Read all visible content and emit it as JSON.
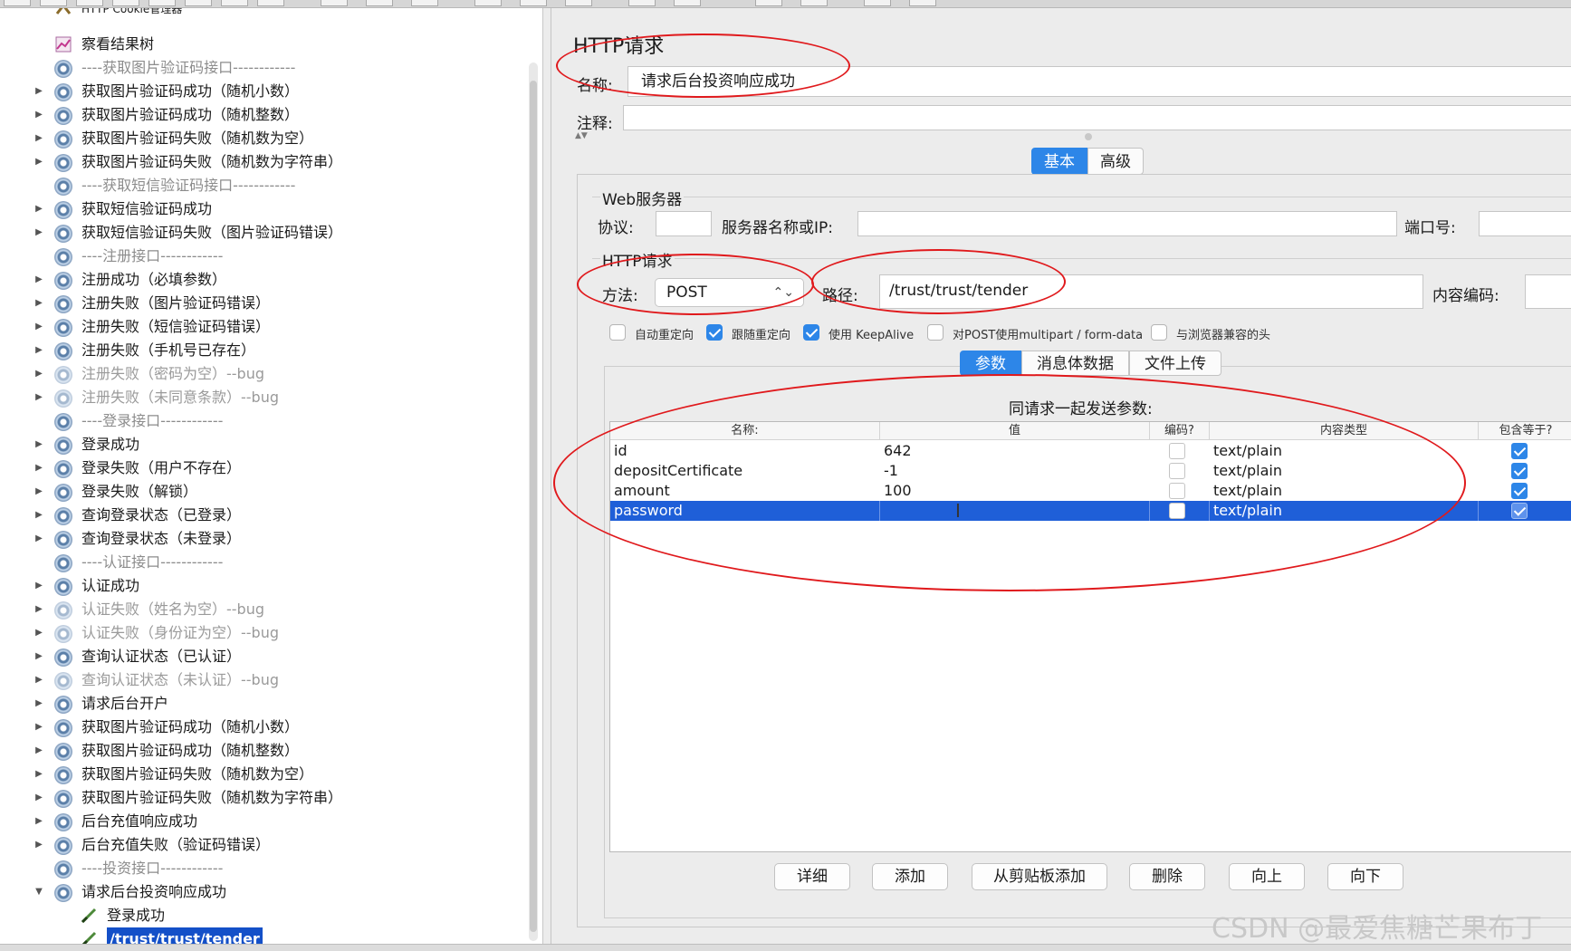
{
  "tree": {
    "items": [
      {
        "label": "HTTP Cookie管理器",
        "indent": 1,
        "kind": "cookie",
        "arrow": false,
        "style": "partial"
      },
      {
        "label": "察看结果树",
        "indent": 1,
        "kind": "listener",
        "arrow": false,
        "style": "normal"
      },
      {
        "label": "----获取图片验证码接口------------",
        "indent": 1,
        "kind": "gear",
        "arrow": false,
        "style": "sep"
      },
      {
        "label": "获取图片验证码成功（随机小数）",
        "indent": 1,
        "kind": "gear",
        "arrow": true,
        "style": "normal"
      },
      {
        "label": "获取图片验证码成功（随机整数）",
        "indent": 1,
        "kind": "gear",
        "arrow": true,
        "style": "normal"
      },
      {
        "label": "获取图片验证码失败（随机数为空）",
        "indent": 1,
        "kind": "gear",
        "arrow": true,
        "style": "normal"
      },
      {
        "label": "获取图片验证码失败（随机数为字符串）",
        "indent": 1,
        "kind": "gear",
        "arrow": true,
        "style": "normal"
      },
      {
        "label": "----获取短信验证码接口------------",
        "indent": 1,
        "kind": "gear",
        "arrow": false,
        "style": "sep"
      },
      {
        "label": "获取短信验证码成功",
        "indent": 1,
        "kind": "gear",
        "arrow": true,
        "style": "normal"
      },
      {
        "label": "获取短信验证码失败（图片验证码错误）",
        "indent": 1,
        "kind": "gear",
        "arrow": true,
        "style": "normal"
      },
      {
        "label": "----注册接口------------",
        "indent": 1,
        "kind": "gear",
        "arrow": false,
        "style": "sep"
      },
      {
        "label": "注册成功（必填参数）",
        "indent": 1,
        "kind": "gear",
        "arrow": true,
        "style": "normal"
      },
      {
        "label": "注册失败（图片验证码错误）",
        "indent": 1,
        "kind": "gear",
        "arrow": true,
        "style": "normal"
      },
      {
        "label": "注册失败（短信验证码错误）",
        "indent": 1,
        "kind": "gear",
        "arrow": true,
        "style": "normal"
      },
      {
        "label": "注册失败（手机号已存在）",
        "indent": 1,
        "kind": "gear",
        "arrow": true,
        "style": "normal"
      },
      {
        "label": "注册失败（密码为空）--bug",
        "indent": 1,
        "kind": "gear",
        "arrow": true,
        "style": "dim"
      },
      {
        "label": "注册失败（未同意条款）--bug",
        "indent": 1,
        "kind": "gear",
        "arrow": true,
        "style": "dim"
      },
      {
        "label": "----登录接口------------",
        "indent": 1,
        "kind": "gear",
        "arrow": false,
        "style": "sep"
      },
      {
        "label": "登录成功",
        "indent": 1,
        "kind": "gear",
        "arrow": true,
        "style": "normal"
      },
      {
        "label": "登录失败（用户不存在）",
        "indent": 1,
        "kind": "gear",
        "arrow": true,
        "style": "normal"
      },
      {
        "label": "登录失败（解锁）",
        "indent": 1,
        "kind": "gear",
        "arrow": true,
        "style": "normal"
      },
      {
        "label": "查询登录状态（已登录）",
        "indent": 1,
        "kind": "gear",
        "arrow": true,
        "style": "normal"
      },
      {
        "label": "查询登录状态（未登录）",
        "indent": 1,
        "kind": "gear",
        "arrow": true,
        "style": "normal"
      },
      {
        "label": "----认证接口------------",
        "indent": 1,
        "kind": "gear",
        "arrow": false,
        "style": "sep"
      },
      {
        "label": "认证成功",
        "indent": 1,
        "kind": "gear",
        "arrow": true,
        "style": "normal"
      },
      {
        "label": "认证失败（姓名为空）--bug",
        "indent": 1,
        "kind": "gear",
        "arrow": true,
        "style": "dim"
      },
      {
        "label": "认证失败（身份证为空）--bug",
        "indent": 1,
        "kind": "gear",
        "arrow": true,
        "style": "dim"
      },
      {
        "label": "查询认证状态（已认证）",
        "indent": 1,
        "kind": "gear",
        "arrow": true,
        "style": "normal"
      },
      {
        "label": "查询认证状态（未认证）--bug",
        "indent": 1,
        "kind": "gear",
        "arrow": true,
        "style": "dim"
      },
      {
        "label": "请求后台开户",
        "indent": 1,
        "kind": "gear",
        "arrow": true,
        "style": "normal"
      },
      {
        "label": "获取图片验证码成功（随机小数）",
        "indent": 1,
        "kind": "gear",
        "arrow": true,
        "style": "normal"
      },
      {
        "label": "获取图片验证码成功（随机整数）",
        "indent": 1,
        "kind": "gear",
        "arrow": true,
        "style": "normal"
      },
      {
        "label": "获取图片验证码失败（随机数为空）",
        "indent": 1,
        "kind": "gear",
        "arrow": true,
        "style": "normal"
      },
      {
        "label": "获取图片验证码失败（随机数为字符串）",
        "indent": 1,
        "kind": "gear",
        "arrow": true,
        "style": "normal"
      },
      {
        "label": "后台充值响应成功",
        "indent": 1,
        "kind": "gear",
        "arrow": true,
        "style": "normal"
      },
      {
        "label": "后台充值失败（验证码错误）",
        "indent": 1,
        "kind": "gear",
        "arrow": true,
        "style": "normal"
      },
      {
        "label": "----投资接口------------",
        "indent": 1,
        "kind": "gear",
        "arrow": false,
        "style": "sep"
      },
      {
        "label": "请求后台投资响应成功",
        "indent": 1,
        "kind": "gear",
        "arrow": "open",
        "style": "normal"
      },
      {
        "label": "登录成功",
        "indent": 2,
        "kind": "sampler",
        "arrow": false,
        "style": "normal"
      },
      {
        "label": "/trust/trust/tender",
        "indent": 2,
        "kind": "sampler",
        "arrow": false,
        "style": "selected"
      }
    ]
  },
  "panel": {
    "title": "HTTP请求",
    "name_label": "名称:",
    "name_value": "请求后台投资响应成功",
    "comment_label": "注释:",
    "comment_value": "",
    "main_tabs": [
      {
        "label": "基本",
        "active": true
      },
      {
        "label": "高级",
        "active": false
      }
    ],
    "web_server": {
      "group_title": "Web服务器",
      "protocol_label": "协议:",
      "protocol_value": "",
      "server_label": "服务器名称或IP:",
      "server_value": "",
      "port_label": "端口号:",
      "port_value": ""
    },
    "http_request": {
      "group_title": "HTTP请求",
      "method_label": "方法:",
      "method_value": "POST",
      "path_label": "路径:",
      "path_value": "/trust/trust/tender",
      "encoding_label": "内容编码:",
      "encoding_value": ""
    },
    "options": [
      {
        "label": "自动重定向",
        "checked": false
      },
      {
        "label": "跟随重定向",
        "checked": true
      },
      {
        "label": "使用 KeepAlive",
        "checked": true
      },
      {
        "label": "对POST使用multipart / form-data",
        "checked": false
      },
      {
        "label": "与浏览器兼容的头",
        "checked": false
      }
    ],
    "sub_tabs": [
      {
        "label": "参数",
        "active": true
      },
      {
        "label": "消息体数据",
        "active": false
      },
      {
        "label": "文件上传",
        "active": false
      }
    ],
    "params_caption": "同请求一起发送参数:",
    "table": {
      "columns": [
        "名称:",
        "值",
        "编码?",
        "内容类型",
        "包含等于?"
      ],
      "rows": [
        {
          "name": "id",
          "value": "642",
          "encode": false,
          "content_type": "text/plain",
          "include_equals": true,
          "selected": false
        },
        {
          "name": "depositCertificate",
          "value": "-1",
          "encode": false,
          "content_type": "text/plain",
          "include_equals": true,
          "selected": false
        },
        {
          "name": "amount",
          "value": "100",
          "encode": false,
          "content_type": "text/plain",
          "include_equals": true,
          "selected": false
        },
        {
          "name": "password",
          "value": "",
          "encode": false,
          "content_type": "text/plain",
          "include_equals": true,
          "selected": true
        }
      ]
    },
    "buttons": [
      "详细",
      "添加",
      "从剪贴板添加",
      "删除",
      "向上",
      "向下"
    ]
  },
  "watermark": "CSDN @最爱焦糖芒果布丁",
  "colors": {
    "accent": "#2d86e8",
    "selection": "#1f5fd8",
    "annotation": "#e0191c"
  }
}
